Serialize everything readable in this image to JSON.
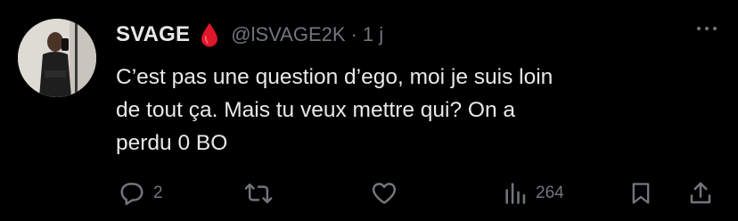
{
  "author": {
    "name": "SVAGE",
    "emoji_icon": "blood-drop-icon",
    "handle": "@lSVAGE2K",
    "separator": "·",
    "time": "1 j"
  },
  "tweet": {
    "lines": [
      "C’est pas une question d’ego, moi je suis loin",
      "de tout ça. Mais tu veux mettre qui? On a",
      "perdu 0 BO"
    ]
  },
  "actions": {
    "reply_count": "2",
    "retweet_count": "",
    "like_count": "",
    "views_count": "264"
  },
  "colors": {
    "background": "#000000",
    "text": "#e7e9ea",
    "muted": "#71767b",
    "drop": "#e0162b"
  }
}
